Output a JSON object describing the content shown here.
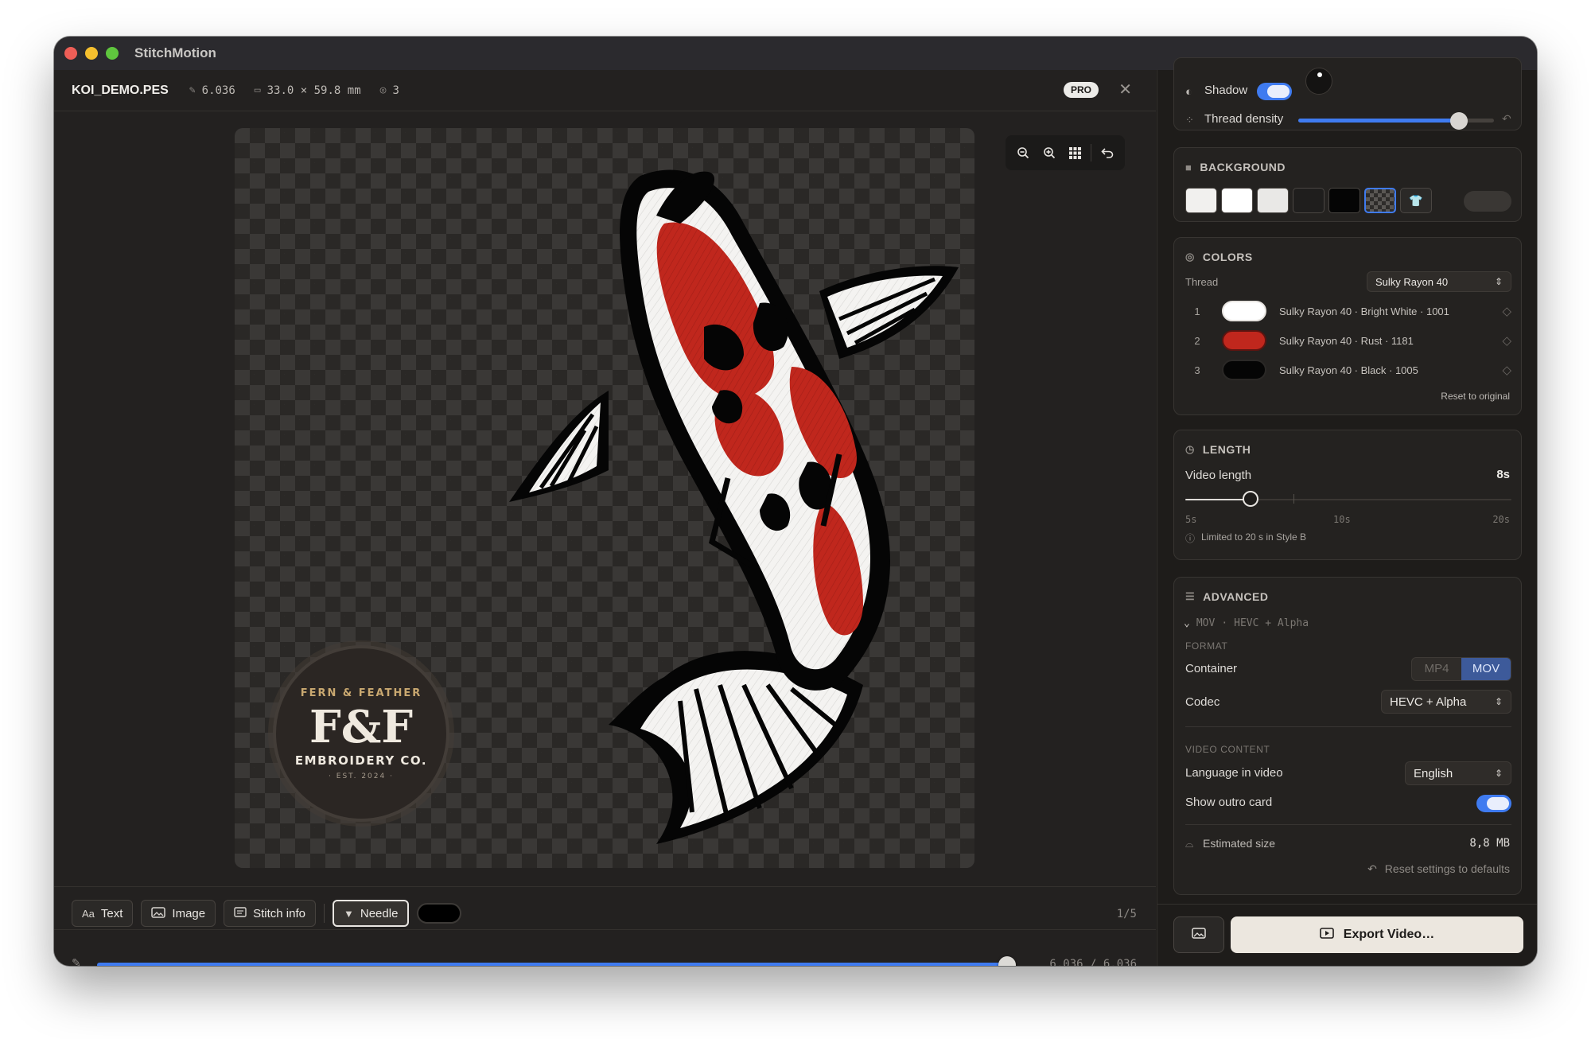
{
  "window": {
    "app_title": "StitchMotion",
    "traffic_colors": [
      "#ee5e57",
      "#f5bf2e",
      "#5fc63e"
    ]
  },
  "file": {
    "name": "KOI_DEMO.PES",
    "stitches": "6.036",
    "dimensions": "33.0 × 59.8 mm",
    "colors_count": "3",
    "badge": "PRO"
  },
  "canvas": {
    "logo": {
      "top_text": "FERN & FEATHER",
      "monogram": "F&F",
      "bottom_text": "EMBROIDERY CO.",
      "est": "· EST. 2024 ·"
    },
    "thread_colors": [
      "#f4f3f1",
      "#c0271d",
      "#050505"
    ],
    "zoom_tools": [
      "zoom-out-icon",
      "zoom-in-icon",
      "grid-icon",
      "undo-icon"
    ]
  },
  "toolbar": {
    "text_label": "Text",
    "text_icon": "Aa",
    "image_label": "Image",
    "stitch_info_label": "Stitch info",
    "needle_label": "Needle",
    "page": "1/5"
  },
  "scrubber": {
    "progress": 1.0,
    "time": "6.036 / 6.036"
  },
  "panel": {
    "shadow_label": "Shadow",
    "shadow_on": true,
    "thread_density_label": "Thread density",
    "thread_density": 0.82,
    "background": {
      "title": "BACKGROUND",
      "swatches": [
        "#f1f0ee",
        "#ffffff",
        "#e9e8e6",
        "#1f1e1d",
        "#050505",
        "checker",
        "shirt"
      ],
      "selected": 5
    },
    "colors": {
      "title": "COLORS",
      "thread_label": "Thread",
      "thread_value": "Sulky Rayon 40",
      "rows": [
        {
          "num": "1",
          "color": "#ffffff",
          "name": "Sulky Rayon 40 · Bright White · 1001"
        },
        {
          "num": "2",
          "color": "#c0271d",
          "name": "Sulky Rayon 40 · Rust · 1181"
        },
        {
          "num": "3",
          "color": "#050505",
          "name": "Sulky Rayon 40 · Black · 1005"
        }
      ],
      "reset_label": "Reset to original"
    },
    "length": {
      "title": "LENGTH",
      "video_length_label": "Video length",
      "video_length_value": "8s",
      "slider_value": 0.2,
      "tick_min": "5s",
      "tick_mid": "10s",
      "tick_max": "20s",
      "note": "Limited to 20 s in Style B"
    },
    "advanced": {
      "title": "ADVANCED",
      "summary_container": "MOV",
      "summary_codec": "HEVC + Alpha",
      "format_label": "FORMAT",
      "container_label": "Container",
      "container_options": [
        "MP4",
        "MOV"
      ],
      "container_selected": "MOV",
      "codec_label": "Codec",
      "codec_value": "HEVC + Alpha",
      "video_content_label": "VIDEO CONTENT",
      "language_label": "Language in video",
      "language_value": "English",
      "outro_label": "Show outro card",
      "outro_on": true,
      "size_label": "Estimated size",
      "size_value": "8,8 MB",
      "reset_label": "Reset settings to defaults"
    },
    "export_label": "Export Video…"
  },
  "colors": {
    "accent": "#3f7bf0"
  }
}
